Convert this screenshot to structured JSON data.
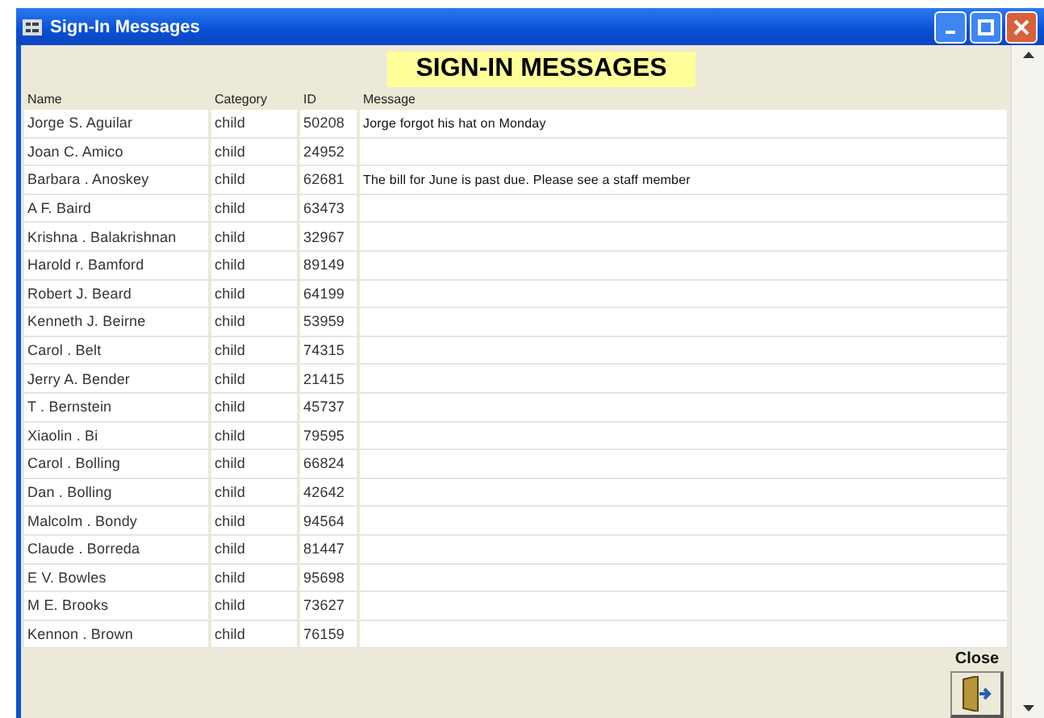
{
  "window": {
    "title": "Sign-In Messages"
  },
  "heading": "SIGN-IN MESSAGES",
  "table": {
    "columns": [
      "Name",
      "Category",
      "ID",
      "Message"
    ],
    "rows": [
      {
        "name": "Jorge S. Aguilar",
        "category": "child",
        "id": "50208",
        "message": "Jorge forgot his hat on Monday"
      },
      {
        "name": "Joan C. Amico",
        "category": "child",
        "id": "24952",
        "message": ""
      },
      {
        "name": "Barbara . Anoskey",
        "category": "child",
        "id": "62681",
        "message": "The bill for June is past due. Please see a staff member"
      },
      {
        "name": "A F. Baird",
        "category": "child",
        "id": "63473",
        "message": ""
      },
      {
        "name": "Krishna . Balakrishnan",
        "category": "child",
        "id": "32967",
        "message": ""
      },
      {
        "name": "Harold r. Bamford",
        "category": "child",
        "id": "89149",
        "message": ""
      },
      {
        "name": "Robert J. Beard",
        "category": "child",
        "id": "64199",
        "message": ""
      },
      {
        "name": "Kenneth J. Beirne",
        "category": "child",
        "id": "53959",
        "message": ""
      },
      {
        "name": "Carol . Belt",
        "category": "child",
        "id": "74315",
        "message": ""
      },
      {
        "name": "Jerry A. Bender",
        "category": "child",
        "id": "21415",
        "message": ""
      },
      {
        "name": "T . Bernstein",
        "category": "child",
        "id": "45737",
        "message": ""
      },
      {
        "name": "Xiaolin . Bi",
        "category": "child",
        "id": "79595",
        "message": ""
      },
      {
        "name": "Carol . Bolling",
        "category": "child",
        "id": "66824",
        "message": ""
      },
      {
        "name": "Dan . Bolling",
        "category": "child",
        "id": "42642",
        "message": ""
      },
      {
        "name": "Malcolm . Bondy",
        "category": "child",
        "id": "94564",
        "message": ""
      },
      {
        "name": "Claude . Borreda",
        "category": "child",
        "id": "81447",
        "message": ""
      },
      {
        "name": "E V. Bowles",
        "category": "child",
        "id": "95698",
        "message": ""
      },
      {
        "name": "M E. Brooks",
        "category": "child",
        "id": "73627",
        "message": ""
      },
      {
        "name": "Kennon . Brown",
        "category": "child",
        "id": "76159",
        "message": ""
      }
    ]
  },
  "close_button": {
    "label": "Close"
  }
}
